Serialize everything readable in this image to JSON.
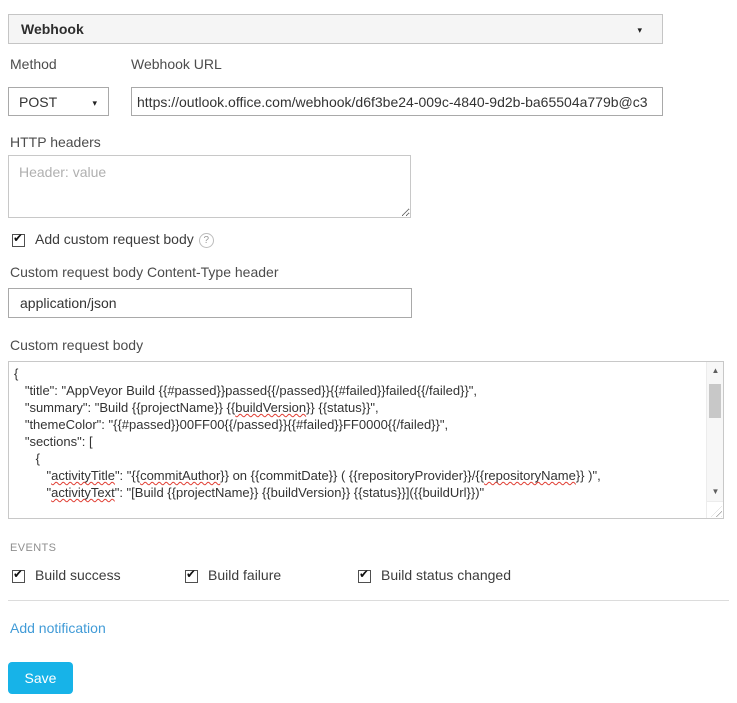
{
  "notification": {
    "type_selector": {
      "value": "Webhook"
    },
    "method": {
      "label": "Method",
      "value": "POST"
    },
    "webhook_url": {
      "label": "Webhook URL",
      "value": "https://outlook.office.com/webhook/d6f3be24-009c-4840-9d2b-ba65504a779b@c3"
    },
    "http_headers": {
      "label": "HTTP headers",
      "placeholder": "Header: value"
    },
    "custom_body_option": {
      "label": "Add custom request body",
      "checked": true,
      "help_glyph": "?"
    },
    "content_type": {
      "label": "Custom request body Content-Type header",
      "value": "application/json"
    },
    "custom_body": {
      "label": "Custom request body",
      "value": "{\n   \"title\": \"AppVeyor Build {{#passed}}passed{{/passed}}{{#failed}}failed{{/failed}}\",\n   \"summary\": \"Build {{projectName}} {{buildVersion}} {{status}}\",\n   \"themeColor\": \"{{#passed}}00FF00{{/passed}}{{#failed}}FF0000{{/failed}}\",\n   \"sections\": [\n      {\n         \"activityTitle\": \"{{commitAuthor}} on {{commitDate}} ( {{repositoryProvider}}/{{repositoryName}} )\",\n         \"activityText\": \"[Build {{projectName}} {{buildVersion}} {{status}}]({{buildUrl}})\"",
      "misspelled_words": [
        "buildVersion",
        "activityTitle",
        "commitAuthor",
        "repositoryName",
        "activityText"
      ]
    },
    "events": {
      "label": "EVENTS",
      "items": [
        {
          "label": "Build success",
          "checked": true
        },
        {
          "label": "Build failure",
          "checked": true
        },
        {
          "label": "Build status changed",
          "checked": true
        }
      ]
    },
    "add_notification_label": "Add notification",
    "save_label": "Save"
  },
  "icons": {
    "dropdown_caret": "▾",
    "scroll_up": "▲",
    "scroll_down": "▼"
  },
  "colors": {
    "accent_button": "#17b3e8",
    "link": "#419bd7",
    "spellcheck_squiggle": "#e03c31",
    "combobox_bg": "#f5f5f5"
  }
}
